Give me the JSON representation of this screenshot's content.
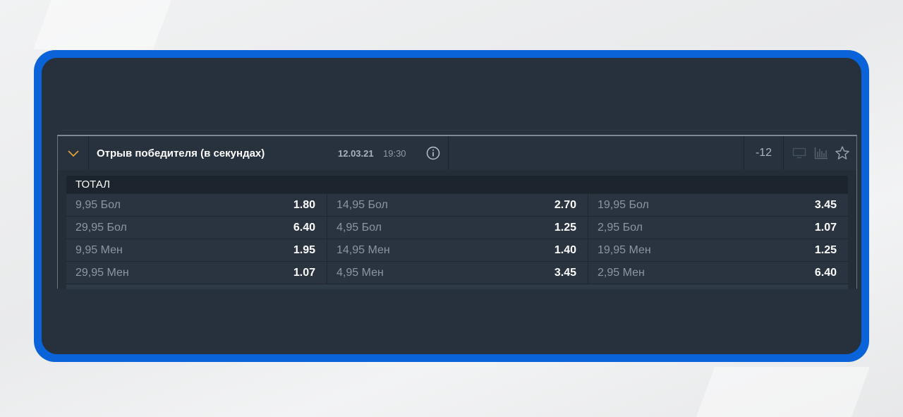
{
  "event": {
    "title": "Отрыв победителя (в секундах)",
    "date": "12.03.21",
    "time": "19:30",
    "count": "-12"
  },
  "icons": {
    "expand": "chevron-down-icon",
    "info": "info-icon",
    "monitor": "monitor-icon",
    "stats": "stats-icon",
    "favorite": "star-icon"
  },
  "colors": {
    "frame": "#0b63d9",
    "panel": "#27313d",
    "accent": "#e8a73a"
  },
  "market": {
    "name": "ТОТАЛ",
    "rows": [
      [
        {
          "label": "9,95 Бол",
          "odds": "1.80"
        },
        {
          "label": "14,95 Бол",
          "odds": "2.70"
        },
        {
          "label": "19,95 Бол",
          "odds": "3.45"
        }
      ],
      [
        {
          "label": "29,95 Бол",
          "odds": "6.40"
        },
        {
          "label": "4,95 Бол",
          "odds": "1.25"
        },
        {
          "label": "2,95 Бол",
          "odds": "1.07"
        }
      ],
      [
        {
          "label": "9,95 Мен",
          "odds": "1.95"
        },
        {
          "label": "14,95 Мен",
          "odds": "1.40"
        },
        {
          "label": "19,95 Мен",
          "odds": "1.25"
        }
      ],
      [
        {
          "label": "29,95 Мен",
          "odds": "1.07"
        },
        {
          "label": "4,95 Мен",
          "odds": "3.45"
        },
        {
          "label": "2,95 Мен",
          "odds": "6.40"
        }
      ]
    ]
  }
}
